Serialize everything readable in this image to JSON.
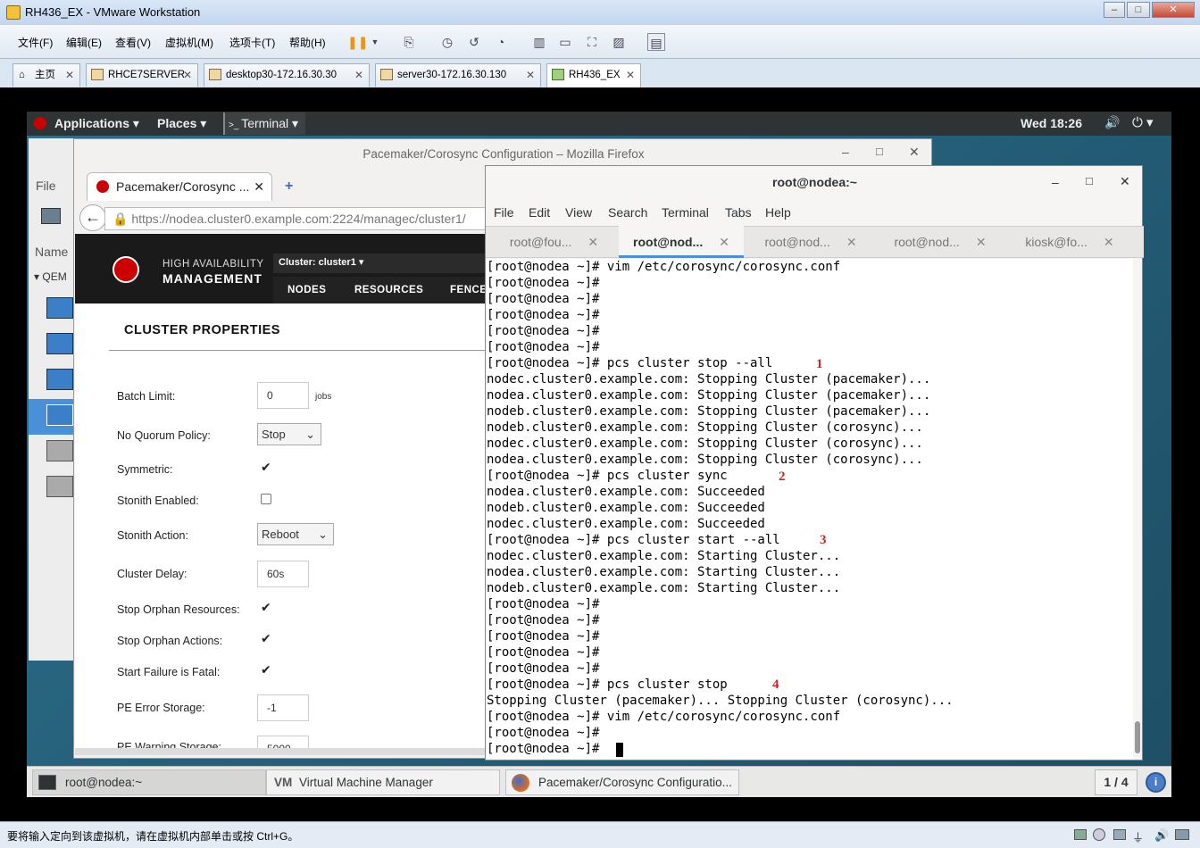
{
  "window": {
    "title": "RH436_EX - VMware Workstation"
  },
  "menu": [
    "文件(F)",
    "编辑(E)",
    "查看(V)",
    "虚拟机(M)",
    "选项卡(T)",
    "帮助(H)"
  ],
  "tabs": [
    "主页",
    "RHCE7SERVER",
    "desktop30-172.16.30.30",
    "server30-172.16.30.130",
    "RH436_EX"
  ],
  "status_hint": "要将输入定向到该虚拟机，请在虚拟机内部单击或按 Ctrl+G。",
  "gnome": {
    "applications": "Applications",
    "places": "Places",
    "terminal": "Terminal",
    "clock": "Wed 18:26"
  },
  "taskbar": {
    "items": [
      "root@nodea:~",
      "Virtual Machine Manager",
      "Pacemaker/Corosync Configuratio..."
    ],
    "workspace": "1 / 4"
  },
  "vmm": {
    "file": "File",
    "name_col": "Name",
    "group": "QEM"
  },
  "firefox": {
    "title": "Pacemaker/Corosync Configuration – Mozilla Firefox",
    "tab": "Pacemaker/Corosync ...",
    "url": "https://nodea.cluster0.example.com:2224/managec/cluster1/",
    "brand_top": "HIGH AVAILABILITY",
    "brand_bottom": "MANAGEMENT",
    "cluster_select": "Cluster: cluster1",
    "nav": [
      "NODES",
      "RESOURCES",
      "FENCE"
    ],
    "heading": "CLUSTER PROPERTIES",
    "props": {
      "batch_limit": {
        "label": "Batch Limit:",
        "value": "0",
        "unit": "jobs"
      },
      "no_quorum": {
        "label": "No Quorum Policy:",
        "value": "Stop"
      },
      "symmetric": {
        "label": "Symmetric:"
      },
      "stonith_enabled": {
        "label": "Stonith Enabled:"
      },
      "stonith_action": {
        "label": "Stonith Action:",
        "value": "Reboot"
      },
      "cluster_delay": {
        "label": "Cluster Delay:",
        "value": "60s"
      },
      "stop_orphan_res": {
        "label": "Stop Orphan Resources:"
      },
      "stop_orphan_act": {
        "label": "Stop Orphan Actions:"
      },
      "start_failure": {
        "label": "Start Failure is Fatal:"
      },
      "pe_error": {
        "label": "PE Error Storage:",
        "value": "-1"
      },
      "pe_warning": {
        "label": "PE Warning Storage:",
        "value": "5000"
      }
    }
  },
  "terminal": {
    "title": "root@nodea:~",
    "menu": [
      "File",
      "Edit",
      "View",
      "Search",
      "Terminal",
      "Tabs",
      "Help"
    ],
    "tabs": [
      "root@fou...",
      "root@nod...",
      "root@nod...",
      "root@nod...",
      "kiosk@fo..."
    ],
    "lines": [
      "[root@nodea ~]# vim /etc/corosync/corosync.conf",
      "[root@nodea ~]#",
      "[root@nodea ~]#",
      "[root@nodea ~]#",
      "[root@nodea ~]#",
      "[root@nodea ~]#",
      "[root@nodea ~]# pcs cluster stop --all",
      "nodec.cluster0.example.com: Stopping Cluster (pacemaker)...",
      "nodea.cluster0.example.com: Stopping Cluster (pacemaker)...",
      "nodeb.cluster0.example.com: Stopping Cluster (pacemaker)...",
      "nodeb.cluster0.example.com: Stopping Cluster (corosync)...",
      "nodec.cluster0.example.com: Stopping Cluster (corosync)...",
      "nodea.cluster0.example.com: Stopping Cluster (corosync)...",
      "[root@nodea ~]# pcs cluster sync",
      "nodea.cluster0.example.com: Succeeded",
      "nodeb.cluster0.example.com: Succeeded",
      "nodec.cluster0.example.com: Succeeded",
      "[root@nodea ~]# pcs cluster start --all",
      "nodec.cluster0.example.com: Starting Cluster...",
      "nodea.cluster0.example.com: Starting Cluster...",
      "nodeb.cluster0.example.com: Starting Cluster...",
      "[root@nodea ~]#",
      "[root@nodea ~]#",
      "[root@nodea ~]#",
      "[root@nodea ~]#",
      "[root@nodea ~]#",
      "[root@nodea ~]# pcs cluster stop",
      "Stopping Cluster (pacemaker)... Stopping Cluster (corosync)...",
      "[root@nodea ~]# vim /etc/corosync/corosync.conf",
      "[root@nodea ~]#",
      "[root@nodea ~]#"
    ],
    "annotations": [
      "1",
      "2",
      "3",
      "4"
    ]
  }
}
